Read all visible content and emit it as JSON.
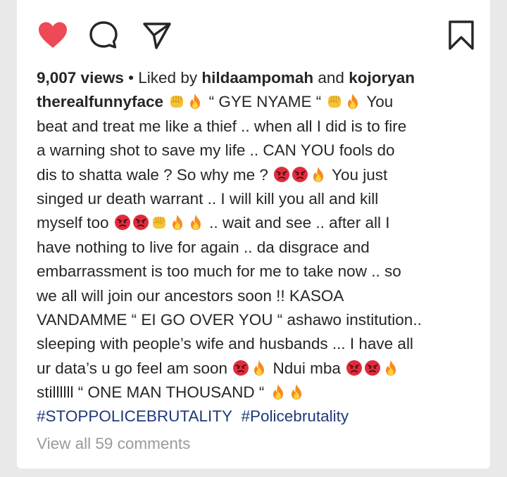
{
  "post": {
    "views": "9,007 views",
    "separator": "•",
    "liked_by_prefix": "Liked by",
    "liker_1": "hildaampomah",
    "and_word": "and",
    "liker_2": "kojoryan",
    "username": "therealfunnyface",
    "caption_lines": {
      "l1a": "“ GYE NYAME “",
      "l1b": "You",
      "l2": "beat and treat me like a thief .. when all I did is to fire",
      "l3": "a warning shot to save my life .. CAN YOU fools do",
      "l4a": "dis to shatta wale ? So why me ?",
      "l4b": "You just",
      "l5": "singed ur death warrant .. I will kill you all and kill",
      "l6a": "myself too",
      "l6b": ".. wait and see .. after all I",
      "l7": "have nothing to live for again .. da disgrace and",
      "l8": "embarrassment is too much for me to take now .. so",
      "l9": "we  all will join our ancestors soon !! KASOA",
      "l10": "VANDAMME “ EI GO OVER YOU “ ashawo institution..",
      "l11": "sleeping with people’s wife and husbands ... I have all",
      "l12a": "ur data’s u go feel am soon",
      "l12b": "Ndui mba",
      "l13": "stillllll “ ONE MAN THOUSAND “"
    },
    "hashtags": [
      "#STOPPOLICEBRUTALITY",
      "#Policebrutality"
    ],
    "view_comments": "View all 59 comments"
  },
  "icons": {
    "like": "heart-icon",
    "comment": "comment-icon",
    "share": "send-icon",
    "save": "bookmark-icon",
    "emoji_fist": "raised-fist-emoji",
    "emoji_fire": "fire-emoji",
    "emoji_angry": "angry-face-emoji"
  },
  "colors": {
    "heart": "#ed4956",
    "hashtag": "#1e3a7a",
    "muted": "#9a9a9a",
    "text": "#262626"
  }
}
